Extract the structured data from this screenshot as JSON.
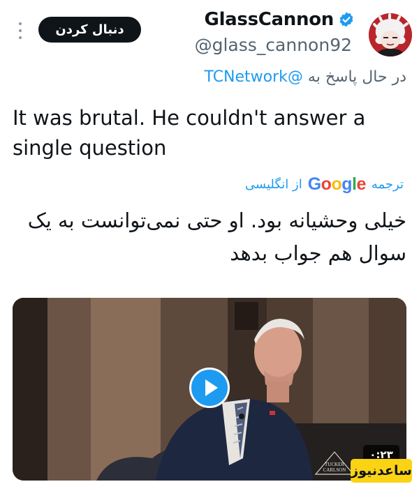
{
  "header": {
    "display_name": "GlassCannon",
    "handle": "@glass_cannon92",
    "follow_label": "دنبال کردن",
    "more_icon": "more-vertical-icon",
    "verified_icon": "verified-badge-icon",
    "verified_color": "#1d9bf0"
  },
  "reply": {
    "prefix": "در حال پاسخ به",
    "mention": "@TCNetwork"
  },
  "tweet": {
    "text": "It was brutal. He couldn't answer a single question"
  },
  "translation": {
    "label_translate": "ترجمه",
    "provider": "Google",
    "label_from": "از انگلیسی",
    "text": "خیلی وحشیانه بود. او حتی نمی‌توانست به یک سوال هم جواب بدهد"
  },
  "media": {
    "type": "video",
    "duration": "۰:۲۳",
    "play_icon": "play-icon",
    "channel_logo_text": "TUCKER CARLSON"
  },
  "watermark": {
    "text": "ساعدنیوز",
    "color": "#fbd315"
  },
  "colors": {
    "accent": "#1d9bf0",
    "text": "#0f1419",
    "muted": "#536471"
  }
}
